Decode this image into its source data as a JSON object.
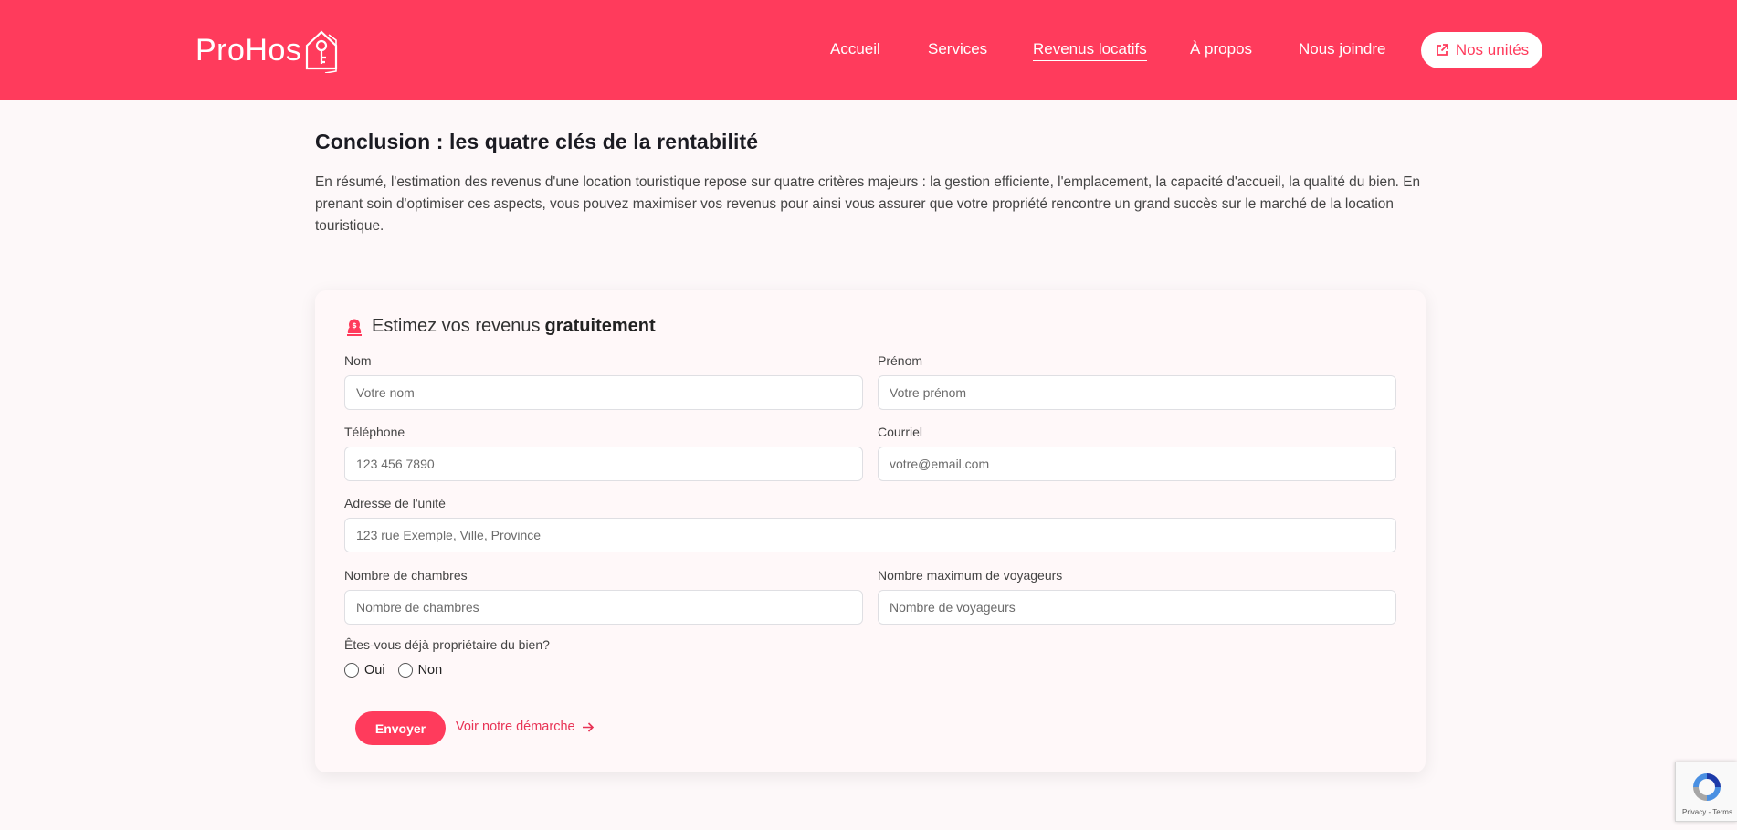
{
  "header": {
    "logo_text": "ProHos",
    "nav": [
      {
        "label": "Accueil",
        "active": false
      },
      {
        "label": "Services",
        "active": false
      },
      {
        "label": "Revenus locatifs",
        "active": true
      },
      {
        "label": "À propos",
        "active": false
      },
      {
        "label": "Nous joindre",
        "active": false
      }
    ],
    "cta_label": "Nos unités",
    "cta_icon": "external-link-icon"
  },
  "article": {
    "title": "Conclusion : les quatre clés de la rentabilité",
    "body": "En résumé, l'estimation des revenus d'une location touristique repose sur quatre critères majeurs : la gestion efficiente, l'emplacement, la capacité d'accueil, la qualité du bien. En prenant soin d'optimiser ces aspects, vous pouvez maximiser vos revenus pour ainsi vous assurer que votre propriété rencontre un grand succès sur le marché de la location touristique."
  },
  "form": {
    "title_prefix": "Estimez vos revenus",
    "title_bold": "gratuitement",
    "title_icon": "money-bag-icon",
    "fields": {
      "nom": {
        "label": "Nom",
        "placeholder": "Votre nom",
        "value": ""
      },
      "prenom": {
        "label": "Prénom",
        "placeholder": "Votre prénom",
        "value": ""
      },
      "telephone": {
        "label": "Téléphone",
        "placeholder": "123 456 7890",
        "value": ""
      },
      "courriel": {
        "label": "Courriel",
        "placeholder": "votre@email.com",
        "value": ""
      },
      "adresse": {
        "label": "Adresse de l'unité",
        "placeholder": "123 rue Exemple, Ville, Province",
        "value": ""
      },
      "chambres": {
        "label": "Nombre de chambres",
        "placeholder": "Nombre de chambres",
        "value": ""
      },
      "voyageurs": {
        "label": "Nombre maximum de voyageurs",
        "placeholder": "Nombre de voyageurs",
        "value": ""
      }
    },
    "owner_question": "Êtes-vous déjà propriétaire du bien?",
    "owner_options": [
      "Oui",
      "Non"
    ],
    "submit_label": "Envoyer",
    "secondary_link": "Voir notre démarche"
  },
  "recaptcha": {
    "links": "Privacy - Terms"
  },
  "colors": {
    "brand": "#ff3b5c",
    "background": "#fdf8f9"
  }
}
